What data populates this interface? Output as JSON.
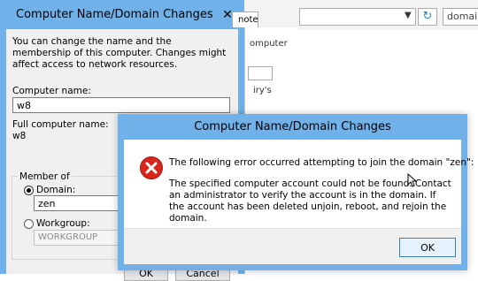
{
  "background": {
    "tab_note": "note",
    "domain_search": "domain",
    "peek_computer": "omputer",
    "peek_irys": "iry's"
  },
  "parent_dialog": {
    "title": "Computer Name/Domain Changes",
    "description": "You can change the name and the membership of this computer. Changes might affect access to network resources.",
    "computer_name_label": "Computer name:",
    "computer_name_value": "w8",
    "full_name_label": "Full computer name:",
    "full_name_value": "w8",
    "member_of_label": "Member of",
    "domain_label": "Domain:",
    "domain_value": "zen",
    "workgroup_label": "Workgroup:",
    "workgroup_value": "WORKGROUP",
    "ok_label": "OK",
    "cancel_label": "Cancel"
  },
  "error_dialog": {
    "title": "Computer Name/Domain Changes",
    "icon": "error-icon",
    "message_line1": "The following error occurred attempting to join the domain \"zen\":",
    "message_line2": "The specified computer account could not be found. Contact an administrator to verify the account is in the domain. If the account has been deleted unjoin, reboot, and rejoin the domain.",
    "ok_label": "OK"
  },
  "colors": {
    "frame_blue": "#6fb1e8",
    "error_red": "#d9261c",
    "footer_gray": "#f0f0f0"
  }
}
